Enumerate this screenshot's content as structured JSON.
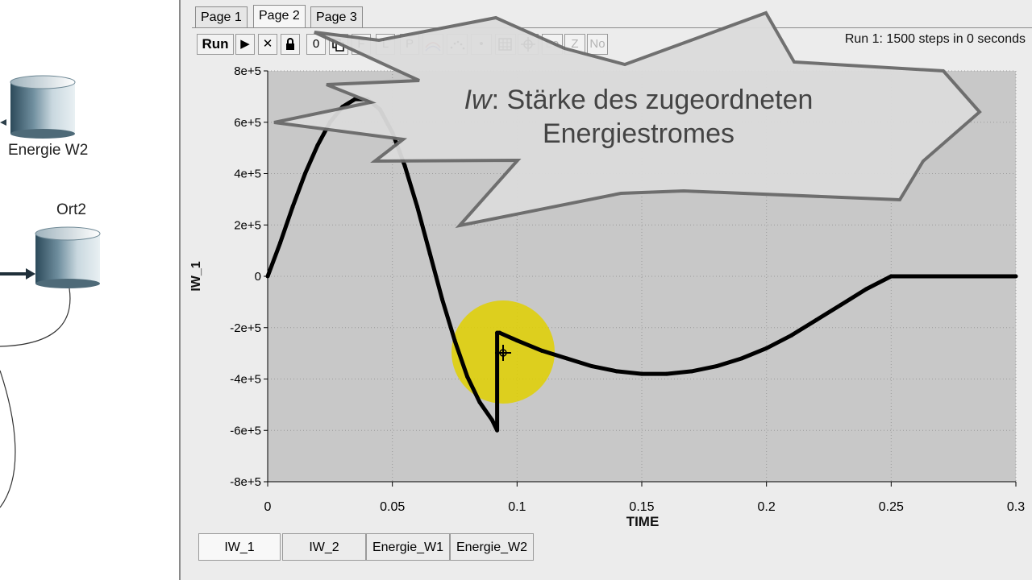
{
  "diagram": {
    "stocks": [
      {
        "label": "Energie W2"
      },
      {
        "label": "Ort2"
      }
    ]
  },
  "window": {
    "tabs": [
      {
        "label": "Page 1",
        "active": false
      },
      {
        "label": "Page 2",
        "active": true
      },
      {
        "label": "Page 3",
        "active": false
      }
    ],
    "toolbar": {
      "run": "Run",
      "play": "▶",
      "stop": "✕",
      "lock": "lock-icon",
      "btn_0": "0",
      "btn_copy": "copy-icon",
      "btn_f": "F",
      "btn_l": "L",
      "btn_p": "P",
      "btn_line": "line-chart-icon",
      "btn_scatter": "scatter-icon",
      "btn_dot": "•",
      "btn_grid": "grid-icon",
      "btn_cross": "crosshair-icon",
      "btn_lo": "Lo",
      "btn_z": "Z",
      "btn_no": "No"
    },
    "status": "Run 1: 1500 steps in 0 seconds",
    "bottom_tabs": [
      {
        "label": "IW_1",
        "active": true
      },
      {
        "label": "IW_2",
        "active": false
      },
      {
        "label": "Energie_W1",
        "active": false
      },
      {
        "label": "Energie_W2",
        "active": false
      }
    ]
  },
  "callout": {
    "symbol": "Iw",
    "text_line1": ": Stärke des zugeordneten",
    "text_line2": "Energiestromes"
  },
  "colors": {
    "plot_bg": "#c8c8c8",
    "curve": "#000000",
    "highlight": "#e0d000"
  },
  "chart_data": {
    "type": "line",
    "xlabel": "TIME",
    "ylabel": "IW_1",
    "xlim": [
      0,
      0.3
    ],
    "ylim": [
      -800000,
      800000
    ],
    "x_ticks": [
      "0",
      "0.05",
      "0.1",
      "0.15",
      "0.2",
      "0.25",
      "0.3"
    ],
    "y_ticks": [
      "8e+5",
      "6e+5",
      "4e+5",
      "2e+5",
      "0",
      "-2e+5",
      "-4e+5",
      "-6e+5",
      "-8e+5"
    ],
    "grid": true,
    "series": [
      {
        "x": [
          0,
          0.005,
          0.01,
          0.015,
          0.02,
          0.025,
          0.03,
          0.035,
          0.04,
          0.045,
          0.05,
          0.055,
          0.06,
          0.065,
          0.07,
          0.075,
          0.08,
          0.085,
          0.09,
          0.092,
          0.092,
          0.093,
          0.1,
          0.11,
          0.12,
          0.13,
          0.14,
          0.15,
          0.16,
          0.17,
          0.18,
          0.19,
          0.2,
          0.21,
          0.22,
          0.23,
          0.24,
          0.25,
          0.253,
          0.26,
          0.27,
          0.28,
          0.29,
          0.3
        ],
        "y": [
          0,
          130000,
          270000,
          400000,
          510000,
          600000,
          660000,
          690000,
          690000,
          650000,
          560000,
          430000,
          270000,
          90000,
          -90000,
          -250000,
          -390000,
          -490000,
          -560000,
          -600000,
          -220000,
          -220000,
          -250000,
          -290000,
          -320000,
          -350000,
          -370000,
          -380000,
          -380000,
          -370000,
          -350000,
          -320000,
          -280000,
          -230000,
          -170000,
          -110000,
          -50000,
          0,
          0,
          0,
          0,
          0,
          0,
          0
        ]
      }
    ]
  }
}
